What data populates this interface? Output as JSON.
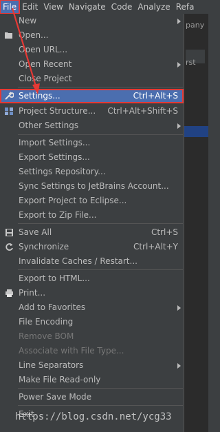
{
  "menubar": {
    "items": [
      {
        "label": "File"
      },
      {
        "label": "Edit"
      },
      {
        "label": "View"
      },
      {
        "label": "Navigate"
      },
      {
        "label": "Code"
      },
      {
        "label": "Analyze"
      },
      {
        "label": "Refa"
      }
    ]
  },
  "background": {
    "text1": "pany",
    "text2": "rst"
  },
  "file_menu": {
    "new": {
      "label": "New"
    },
    "open": {
      "label": "Open..."
    },
    "open_url": {
      "label": "Open URL..."
    },
    "open_recent": {
      "label": "Open Recent"
    },
    "close_project": {
      "label": "Close Project"
    },
    "settings": {
      "label": "Settings...",
      "shortcut": "Ctrl+Alt+S"
    },
    "project_structure": {
      "label": "Project Structure...",
      "shortcut": "Ctrl+Alt+Shift+S"
    },
    "other_settings": {
      "label": "Other Settings"
    },
    "import_settings": {
      "label": "Import Settings..."
    },
    "export_settings": {
      "label": "Export Settings..."
    },
    "settings_repository": {
      "label": "Settings Repository..."
    },
    "sync_settings": {
      "label": "Sync Settings to JetBrains Account..."
    },
    "export_eclipse": {
      "label": "Export Project to Eclipse..."
    },
    "export_zip": {
      "label": "Export to Zip File..."
    },
    "save_all": {
      "label": "Save All",
      "shortcut": "Ctrl+S"
    },
    "synchronize": {
      "label": "Synchronize",
      "shortcut": "Ctrl+Alt+Y"
    },
    "invalidate_caches": {
      "label": "Invalidate Caches / Restart..."
    },
    "export_html": {
      "label": "Export to HTML..."
    },
    "print": {
      "label": "Print..."
    },
    "add_favorites": {
      "label": "Add to Favorites"
    },
    "file_encoding": {
      "label": "File Encoding"
    },
    "remove_bom": {
      "label": "Remove BOM"
    },
    "associate_file_type": {
      "label": "Associate with File Type..."
    },
    "line_separators": {
      "label": "Line Separators"
    },
    "make_read_only": {
      "label": "Make File Read-only"
    },
    "power_save": {
      "label": "Power Save Mode"
    },
    "exit": {
      "label": "Exit"
    }
  },
  "watermark": {
    "text": "https://blog.csdn.net/ycg33"
  },
  "colors": {
    "selection": "#4b6eaf",
    "annotation": "#e53935",
    "menu_bg": "#3c3f41"
  }
}
